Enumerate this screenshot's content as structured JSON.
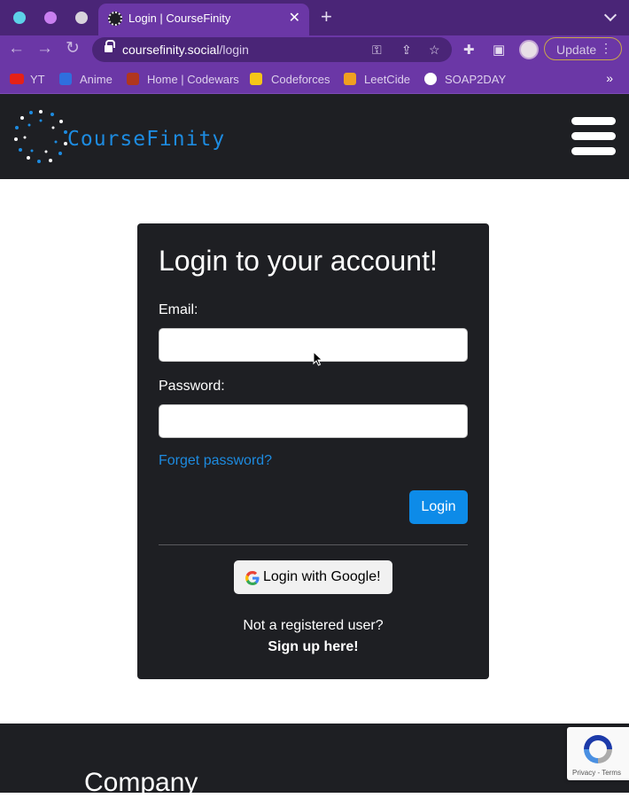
{
  "browser": {
    "tab_title": "Login | CourseFinity",
    "tab_close": "✕",
    "new_tab": "+",
    "url_host": "coursefinity.social",
    "url_path": "/login",
    "update_label": "Update",
    "bookmarks": [
      {
        "label": "YT",
        "icon_color": "#e62117"
      },
      {
        "label": "Anime",
        "icon_color": "#2f6fde"
      },
      {
        "label": "Home | Codewars",
        "icon_color": "#b1361e"
      },
      {
        "label": "Codeforces",
        "icon_color": "#f5c518"
      },
      {
        "label": "LeetCide",
        "icon_color": "#f0a020"
      },
      {
        "label": "SOAP2DAY",
        "icon_color": "#ffffff"
      }
    ],
    "bookmarks_more": "»",
    "traffic_lights": [
      "#5dd1e8",
      "#c97ff0",
      "#d8d3dc"
    ]
  },
  "header": {
    "brand": "CourseFinity",
    "brand_color": "#1d8be0"
  },
  "login": {
    "title": "Login to your account!",
    "email_label": "Email:",
    "email_value": "",
    "password_label": "Password:",
    "password_value": "",
    "forgot_link": "Forget password?",
    "login_button": "Login",
    "google_button": "Login with Google!",
    "not_registered": "Not a registered user?",
    "signup_link": "Sign up here!"
  },
  "footer": {
    "heading": "Company"
  },
  "recaptcha": {
    "links": "Privacy - Terms"
  }
}
